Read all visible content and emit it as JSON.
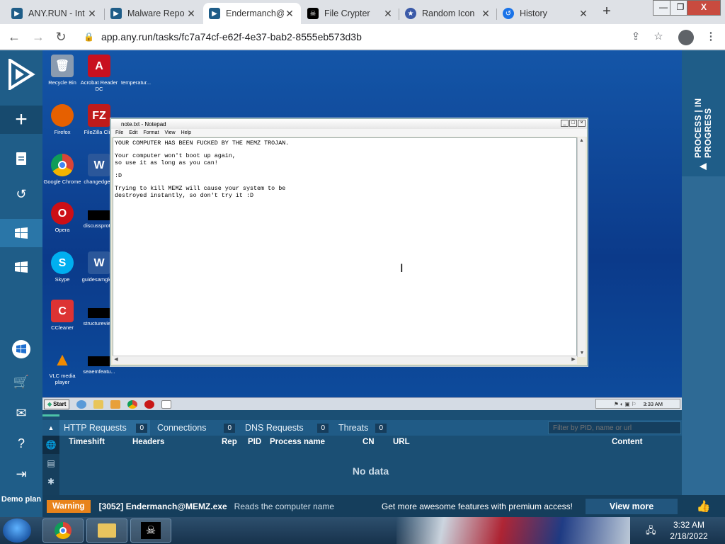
{
  "browser": {
    "tabs": [
      {
        "label": "ANY.RUN - Int",
        "icon": "anyrun-icon",
        "color": "#1f5d88"
      },
      {
        "label": "Malware Repo",
        "icon": "anyrun-icon",
        "color": "#1f5d88"
      },
      {
        "label": "Endermanch@",
        "icon": "anyrun-icon",
        "color": "#1f5d88",
        "active": true
      },
      {
        "label": "File Crypter",
        "icon": "pirate-flag-icon",
        "color": "#000000"
      },
      {
        "label": "Random Icon",
        "icon": "star-badge-icon",
        "color": "#3b5aa8"
      },
      {
        "label": "History",
        "icon": "history-icon",
        "color": "#1a73e8"
      }
    ],
    "url": "app.any.run/tasks/fc7a74cf-e62f-4e37-bab2-8555eb573d3b"
  },
  "sidebar": {
    "demo_plan": "Demo plan"
  },
  "right_panel": {
    "label": "PROCESS | IN PROGRESS"
  },
  "desktop": {
    "icons": [
      {
        "label": "Recycle Bin",
        "color": "#8a9bb0",
        "glyph": "🗑"
      },
      {
        "label": "Acrobat Reader DC",
        "color": "#c8101f",
        "glyph": "A"
      },
      {
        "label": "temperatur...",
        "color": "transparent",
        "glyph": ""
      },
      {
        "label": "Firefox",
        "color": "#e66000",
        "glyph": "●"
      },
      {
        "label": "FileZilla Cli...",
        "color": "#bf1b1b",
        "glyph": "FZ"
      },
      {
        "label": "Google Chrome",
        "color": "#2a9d4a",
        "glyph": "●"
      },
      {
        "label": "changedge...",
        "color": "#2b579a",
        "glyph": "W"
      },
      {
        "label": "Opera",
        "color": "#cc0f16",
        "glyph": "O"
      },
      {
        "label": "discussprot...",
        "color": "#000000",
        "glyph": ""
      },
      {
        "label": "Skype",
        "color": "#00aff0",
        "glyph": "S"
      },
      {
        "label": "guidesamgle...",
        "color": "#2b579a",
        "glyph": "W"
      },
      {
        "label": "CCleaner",
        "color": "#d33",
        "glyph": "C"
      },
      {
        "label": "structurevie...",
        "color": "#000000",
        "glyph": ""
      },
      {
        "label": "VLC media player",
        "color": "#f08a00",
        "glyph": "▲"
      },
      {
        "label": "seaemfeatu...",
        "color": "#000000",
        "glyph": ""
      }
    ]
  },
  "notepad": {
    "title": "note.txt - Notepad",
    "menu": [
      "File",
      "Edit",
      "Format",
      "View",
      "Help"
    ],
    "lines": [
      "YOUR COMPUTER HAS BEEN FUCKED BY THE MEMZ TROJAN.",
      "",
      "Your computer won't boot up again,",
      "so use it as long as you can!",
      "",
      ":D",
      "",
      "Trying to kill MEMZ will cause your system to be",
      "destroyed instantly, so don't try it :D"
    ]
  },
  "vm_taskbar": {
    "start": "Start",
    "time": "3:33 AM"
  },
  "network": {
    "tabs": [
      {
        "label": "HTTP Requests",
        "count": "0",
        "active": true
      },
      {
        "label": "Connections",
        "count": "0"
      },
      {
        "label": "DNS Requests",
        "count": "0"
      },
      {
        "label": "Threats",
        "count": "0"
      }
    ],
    "filter_placeholder": "Filter by PID, name or url",
    "columns": [
      "Timeshift",
      "Headers",
      "Rep",
      "PID",
      "Process name",
      "CN",
      "URL",
      "Content"
    ],
    "empty": "No data"
  },
  "status": {
    "badge": "Warning",
    "process": "[3052] Endermanch@MEMZ.exe",
    "message": "Reads the computer name",
    "promo": "Get more awesome features with premium access!",
    "view_more": "View more"
  },
  "windows_taskbar": {
    "time": "3:32 AM",
    "date": "2/18/2022"
  }
}
